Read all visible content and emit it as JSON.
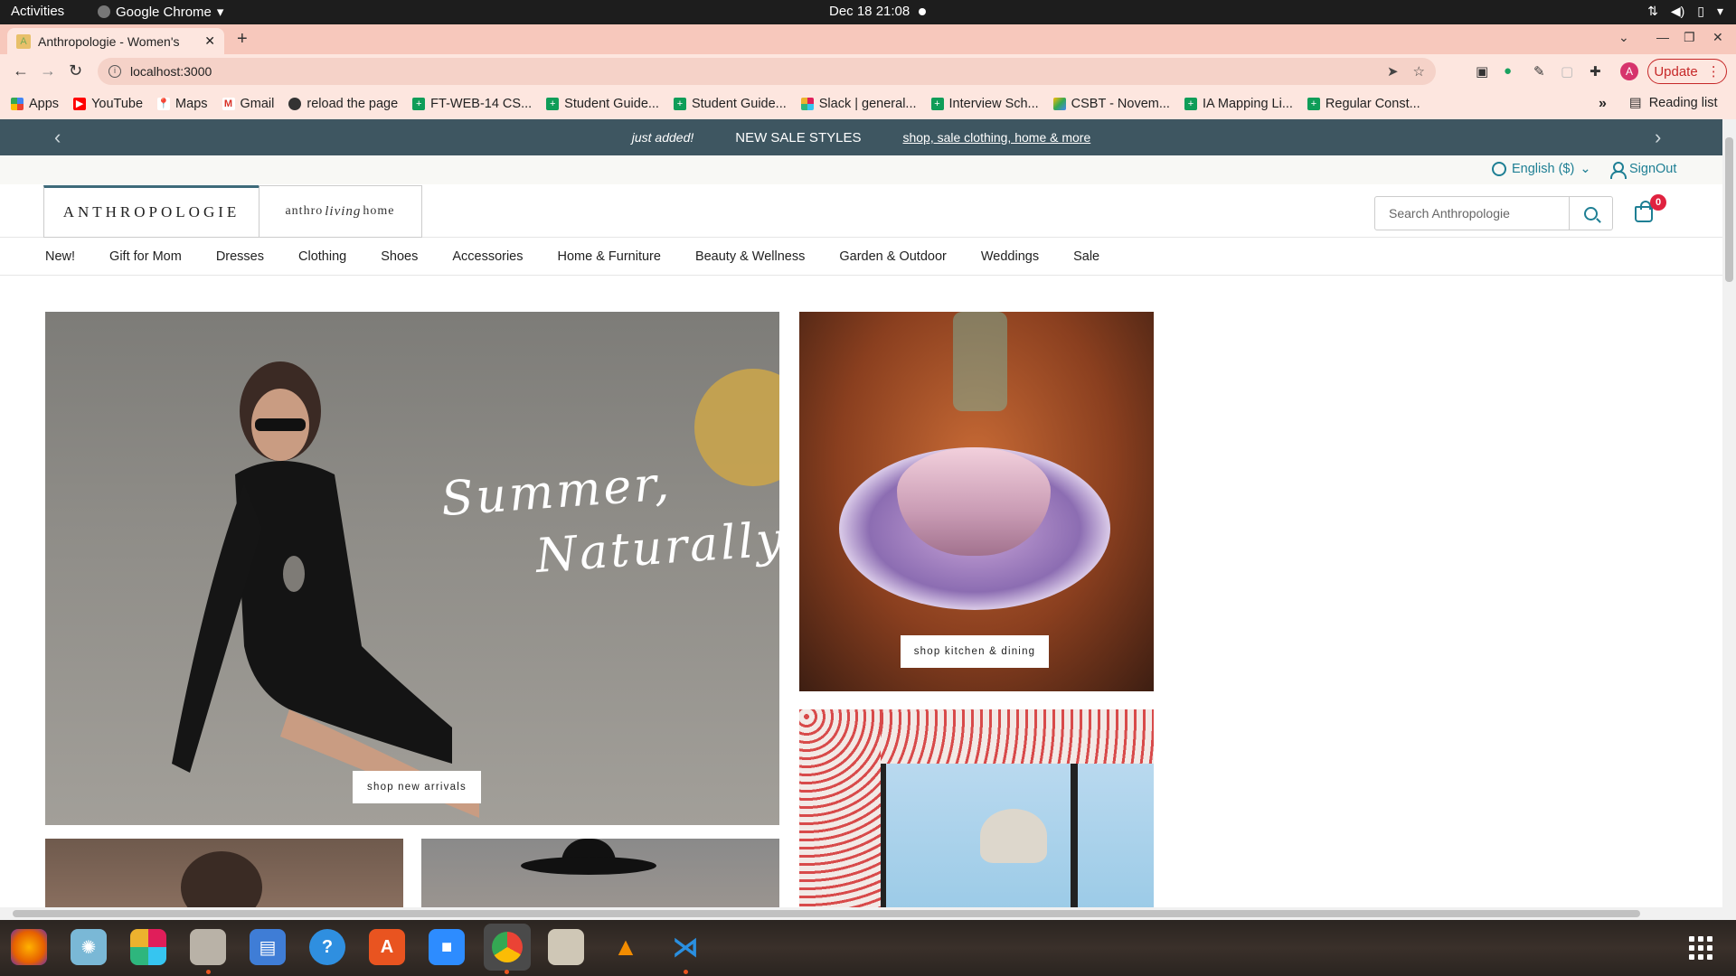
{
  "gnome": {
    "activities": "Activities",
    "app_menu": "Google Chrome",
    "clock": "Dec 18  21:08"
  },
  "browser": {
    "tab_title": "Anthropologie - Women's",
    "url": "localhost:3000",
    "update_label": "Update",
    "profile_initial": "A",
    "bookmarks": [
      {
        "label": "Apps",
        "icon": "apps-grid-icon"
      },
      {
        "label": "YouTube",
        "icon": "youtube-icon"
      },
      {
        "label": "Maps",
        "icon": "maps-icon"
      },
      {
        "label": "Gmail",
        "icon": "gmail-icon"
      },
      {
        "label": "reload the page",
        "icon": "globe-icon"
      },
      {
        "label": "FT-WEB-14 CS...",
        "icon": "sheets-icon"
      },
      {
        "label": "Student Guide...",
        "icon": "sheets-icon"
      },
      {
        "label": "Student Guide...",
        "icon": "sheets-icon"
      },
      {
        "label": "Slack | general...",
        "icon": "slack-icon"
      },
      {
        "label": "Interview Sch...",
        "icon": "sheets-icon"
      },
      {
        "label": "CSBT - Novem...",
        "icon": "drive-icon"
      },
      {
        "label": "IA Mapping Li...",
        "icon": "sheets-icon"
      },
      {
        "label": "Regular Const...",
        "icon": "sheets-icon"
      }
    ],
    "bookmarks_more": "»",
    "reading_list": "Reading list"
  },
  "site": {
    "promo": {
      "just_added": "just added!",
      "headline": "NEW SALE STYLES",
      "link": "shop, sale clothing, home & more"
    },
    "utility": {
      "language": "English ($)",
      "signout": "SignOut"
    },
    "logo_main": "ANTHROPOLOGIE",
    "logo_home": {
      "pre": "anthro",
      "script": "living",
      "post": "home"
    },
    "search_placeholder": "Search Anthropologie",
    "cart_count": "0",
    "nav": [
      "New!",
      "Gift for Mom",
      "Dresses",
      "Clothing",
      "Shoes",
      "Accessories",
      "Home & Furniture",
      "Beauty & Wellness",
      "Garden & Outdoor",
      "Weddings",
      "Sale"
    ],
    "hero": {
      "script_line1": "Summer,",
      "script_line2": "Naturally",
      "cta": "shop new arrivals"
    },
    "kitchen": {
      "cta": "shop kitchen & dining"
    }
  },
  "colors": {
    "promo_bg": "#3e5661",
    "accent_teal": "#1e7f94",
    "cart_badge": "#e0223f",
    "chrome_tabstrip": "#f7c8bc"
  }
}
